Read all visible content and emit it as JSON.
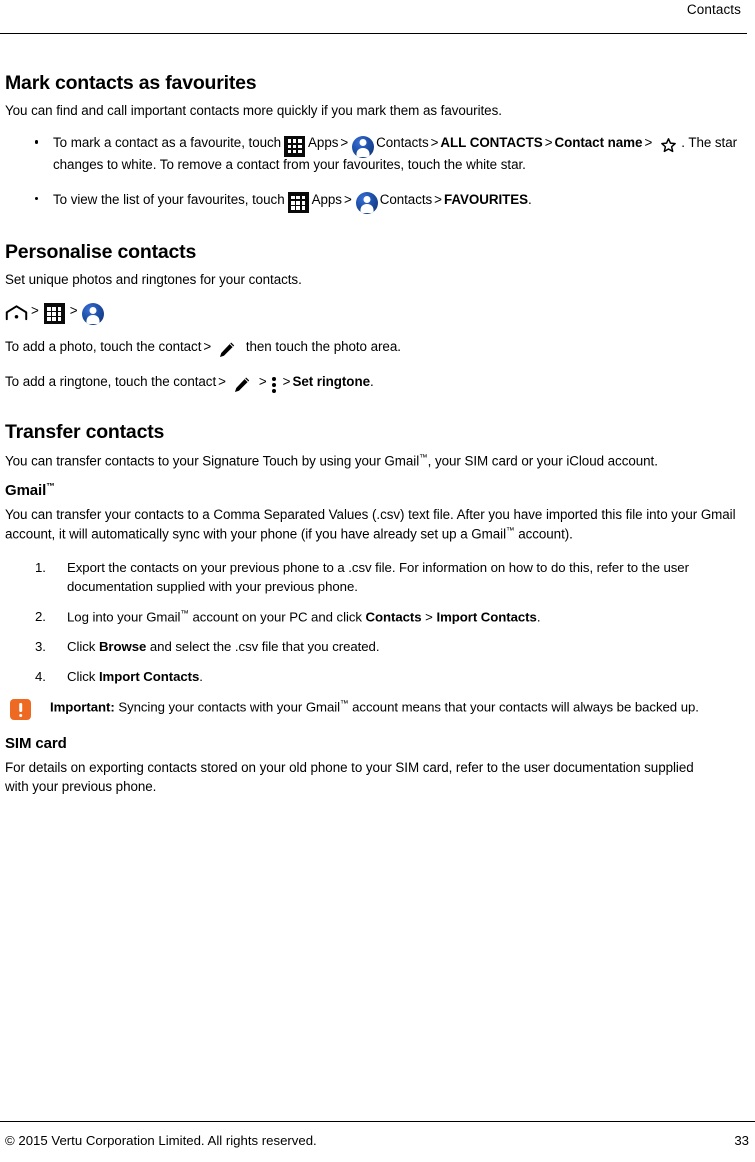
{
  "header": {
    "title": "Contacts"
  },
  "sections": {
    "favourites": {
      "heading": "Mark contacts as favourites",
      "intro": "You can find and call important contacts more quickly if you mark them as favourites.",
      "bullet1": {
        "part1": "To mark a contact as a favourite, touch",
        "apps_label": "Apps",
        "contacts_label": "Contacts",
        "all_contacts_label": "ALL CONTACTS",
        "contact_name_label": "Contact name",
        "part2": ". The star changes to white. To remove a contact from your favourites, touch the white star."
      },
      "bullet2": {
        "part1": "To view the list of your favourites, touch",
        "apps_label": "Apps",
        "contacts_label": "Contacts",
        "favourites_label": "FAVOURITES",
        "part2": "."
      }
    },
    "personalise": {
      "heading": "Personalise contacts",
      "intro": "Set unique photos and ringtones for your contacts.",
      "photo_line": {
        "part1": "To add a photo, touch the contact",
        "part2": "then touch the photo area."
      },
      "ringtone_line": {
        "part1": "To add a ringtone, touch the contact",
        "set_ringtone_label": "Set ringtone",
        "part2": "."
      }
    },
    "transfer": {
      "heading": "Transfer contacts",
      "intro_a": "You can transfer contacts to your Signature Touch by using your Gmail",
      "intro_tm": "™",
      "intro_b": ", your SIM card or your iCloud account.",
      "gmail": {
        "heading_text": "Gmail",
        "heading_tm": "™",
        "para_a": "You can transfer your contacts to a Comma Separated Values (.csv) text file. After you have imported this file into your Gmail account, it will automatically sync with your phone (if you have already set up a Gmail",
        "para_tm": "™",
        "para_b": " account).",
        "steps": [
          {
            "number": "1.",
            "text": "Export the contacts on your previous phone to a .csv file. For information on how to do this, refer to the user documentation supplied with your previous phone."
          },
          {
            "number": "2.",
            "pre": "Log into your Gmail",
            "tm": "™",
            "mid": " account on your PC and click ",
            "bold1": "Contacts",
            "gt": " > ",
            "bold2": "Import Contacts",
            "post": "."
          },
          {
            "number": "3.",
            "pre": "Click ",
            "bold1": "Browse",
            "post": " and select the .csv file that you created."
          },
          {
            "number": "4.",
            "pre": "Click ",
            "bold1": "Import Contacts",
            "post": "."
          }
        ],
        "note": {
          "label": "Important:",
          "text_a": " Syncing your contacts with your Gmail",
          "tm": "™",
          "text_b": " account means that your contacts will always be backed up."
        }
      },
      "sim": {
        "heading": "SIM card",
        "para": "For details on exporting contacts stored on your old phone to your SIM card, refer to the user documentation supplied with your previous phone."
      }
    }
  },
  "footer": {
    "copyright": "© 2015 Vertu Corporation Limited. All rights reserved.",
    "page_number": "33"
  },
  "colors": {
    "note_orange": "#EE6A23",
    "contacts_blue": "#1d4fa8",
    "apps_black": "#0a0a0a"
  }
}
